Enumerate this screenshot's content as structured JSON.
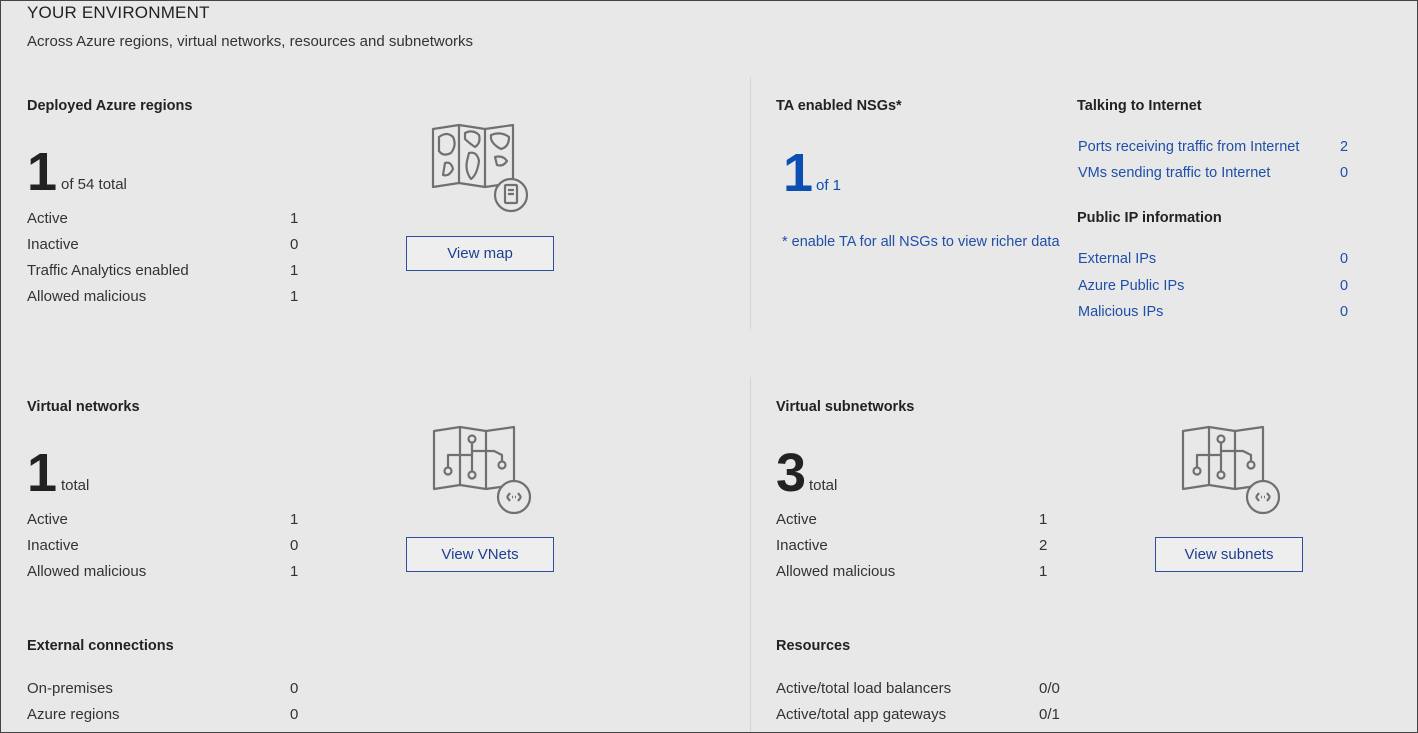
{
  "header": {
    "title": "YOUR ENVIRONMENT",
    "subtitle": "Across Azure regions, virtual networks, resources and subnetworks"
  },
  "regions": {
    "title": "Deployed Azure regions",
    "big": "1",
    "after": "of 54 total",
    "rows": [
      {
        "label": "Active",
        "value": "1"
      },
      {
        "label": "Inactive",
        "value": "0"
      },
      {
        "label": "Traffic Analytics enabled",
        "value": "1"
      },
      {
        "label": "Allowed malicious",
        "value": "1"
      }
    ],
    "button": "View map",
    "icon": "world-map-icon"
  },
  "nsgs": {
    "title": "TA enabled NSGs*",
    "big": "1",
    "after": "of 1",
    "note": "* enable TA for all NSGs to view richer data"
  },
  "internet": {
    "title": "Talking to Internet",
    "links": [
      {
        "label": "Ports receiving traffic from Internet",
        "value": "2"
      },
      {
        "label": "VMs sending traffic to Internet",
        "value": "0"
      }
    ]
  },
  "public_ip": {
    "title": "Public IP information",
    "links": [
      {
        "label": "External IPs",
        "value": "0"
      },
      {
        "label": "Azure Public IPs",
        "value": "0"
      },
      {
        "label": "Malicious IPs",
        "value": "0"
      }
    ]
  },
  "vnets": {
    "title": "Virtual networks",
    "big": "1",
    "after": "total",
    "rows": [
      {
        "label": "Active",
        "value": "1"
      },
      {
        "label": "Inactive",
        "value": "0"
      },
      {
        "label": "Allowed malicious",
        "value": "1"
      }
    ],
    "button": "View VNets",
    "icon": "network-map-icon"
  },
  "subnets": {
    "title": "Virtual subnetworks",
    "big": "3",
    "after": "total",
    "rows": [
      {
        "label": "Active",
        "value": "1"
      },
      {
        "label": "Inactive",
        "value": "2"
      },
      {
        "label": "Allowed malicious",
        "value": "1"
      }
    ],
    "button": "View subnets",
    "icon": "network-map-icon"
  },
  "external": {
    "title": "External connections",
    "rows": [
      {
        "label": "On-premises",
        "value": "0"
      },
      {
        "label": "Azure regions",
        "value": "0"
      }
    ]
  },
  "resources": {
    "title": "Resources",
    "rows": [
      {
        "label": "Active/total load balancers",
        "value": "0/0"
      },
      {
        "label": "Active/total app gateways",
        "value": "0/1"
      }
    ]
  },
  "colors": {
    "accent": "#0b4fb3",
    "link": "#1f4fa8",
    "background": "#e8e8e8"
  }
}
